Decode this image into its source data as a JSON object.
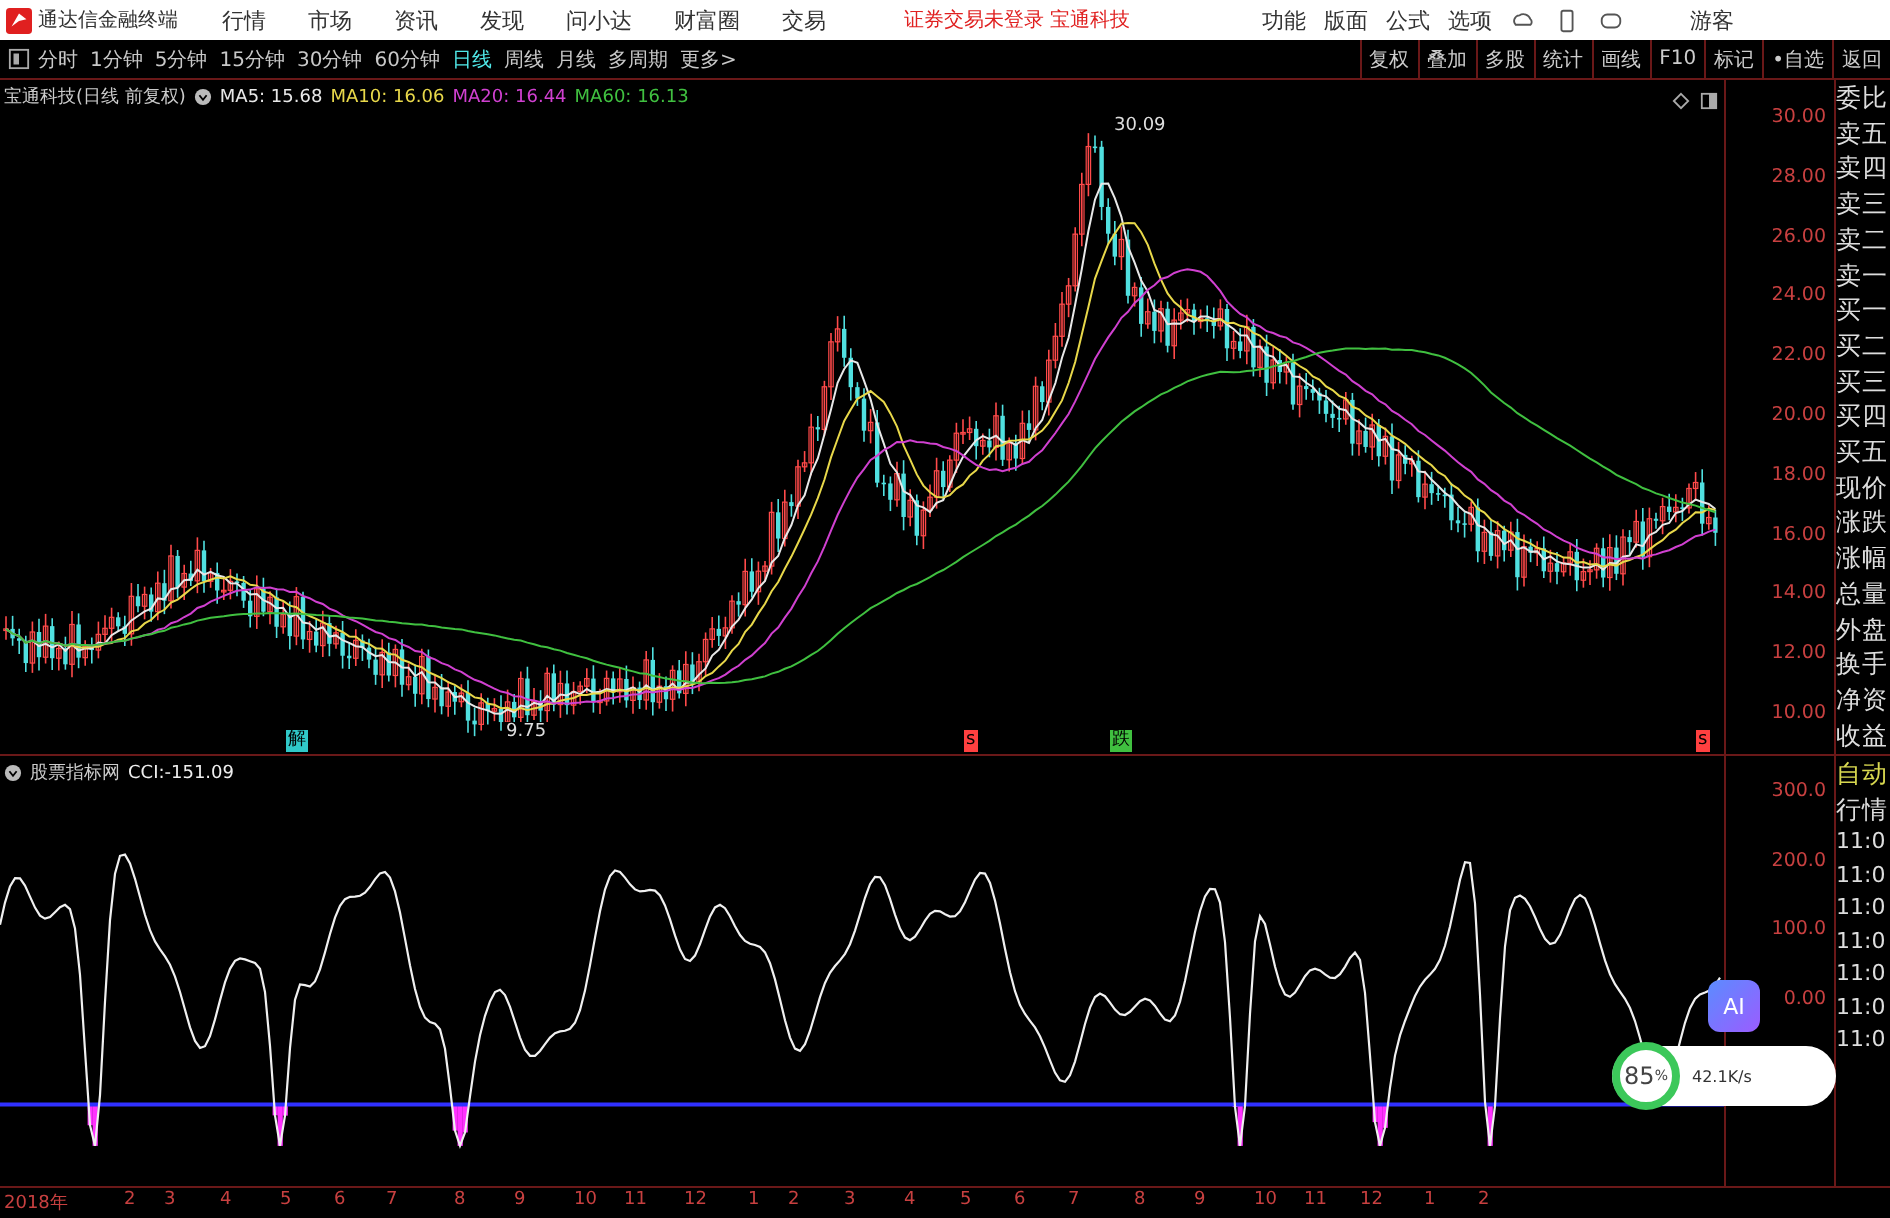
{
  "app": {
    "name": "通达信金融终端"
  },
  "menu": [
    "行情",
    "市场",
    "资讯",
    "发现",
    "问小达",
    "财富圈",
    "交易"
  ],
  "notice": "证券交易未登录 宝通科技",
  "top_right_menu": [
    "功能",
    "版面",
    "公式",
    "选项"
  ],
  "user": "游客",
  "periods": [
    {
      "label": "分时",
      "selected": false
    },
    {
      "label": "1分钟",
      "selected": false
    },
    {
      "label": "5分钟",
      "selected": false
    },
    {
      "label": "15分钟",
      "selected": false
    },
    {
      "label": "30分钟",
      "selected": false
    },
    {
      "label": "60分钟",
      "selected": false
    },
    {
      "label": "日线",
      "selected": true
    },
    {
      "label": "周线",
      "selected": false
    },
    {
      "label": "月线",
      "selected": false
    },
    {
      "label": "多周期",
      "selected": false
    },
    {
      "label": "更多>",
      "selected": false
    }
  ],
  "tools": [
    "复权",
    "叠加",
    "多股",
    "统计",
    "画线",
    "F10",
    "标记",
    "•自选",
    "返回"
  ],
  "main_chart": {
    "title": "宝通科技(日线 前复权)",
    "ma": [
      {
        "name": "MA5:",
        "value": "15.68",
        "color": "#e8e8e8"
      },
      {
        "name": "MA10:",
        "value": "16.06",
        "color": "#e8d84a"
      },
      {
        "name": "MA20:",
        "value": "16.44",
        "color": "#d040d0"
      },
      {
        "name": "MA60:",
        "value": "16.13",
        "color": "#40c040"
      }
    ],
    "high_label": "30.09",
    "low_label": "9.75",
    "price_ticks": [
      "30.00",
      "28.00",
      "26.00",
      "24.00",
      "22.00",
      "20.00",
      "18.00",
      "16.00",
      "14.00",
      "12.00",
      "10.00"
    ],
    "markers": [
      {
        "text": "解",
        "color": "#30c8c8"
      },
      {
        "text": "s",
        "color": "#ff4040"
      },
      {
        "text": "跌",
        "color": "#40c040"
      },
      {
        "text": "s",
        "color": "#ff4040"
      }
    ]
  },
  "quote_labels": [
    "委比",
    "卖五",
    "卖四",
    "卖三",
    "卖二",
    "卖一",
    "买一",
    "买二",
    "买三",
    "买四",
    "买五",
    "现价",
    "涨跌",
    "涨幅",
    "总量",
    "外盘",
    "换手",
    "净资",
    "收益"
  ],
  "indicator": {
    "title": "股票指标网",
    "reading": "CCI:-151.09",
    "ticks": [
      "300.0",
      "200.0",
      "100.0",
      "0.00"
    ]
  },
  "indicator_side": {
    "labels": [
      "自动",
      "行情"
    ],
    "times": [
      "11:0",
      "11:0",
      "11:0",
      "11:0",
      "11:0",
      "11:0",
      "11:0"
    ]
  },
  "time_axis": [
    "2018年",
    "2",
    "3",
    "4",
    "5",
    "6",
    "7",
    "8",
    "9",
    "10",
    "11",
    "12",
    "1",
    "2",
    "3",
    "4",
    "5",
    "6",
    "7",
    "8",
    "9",
    "10",
    "11",
    "12",
    "1",
    "2"
  ],
  "overlay": {
    "badge": "AI",
    "percent": "85",
    "unit": "%",
    "speed": "42.1K/s"
  }
}
